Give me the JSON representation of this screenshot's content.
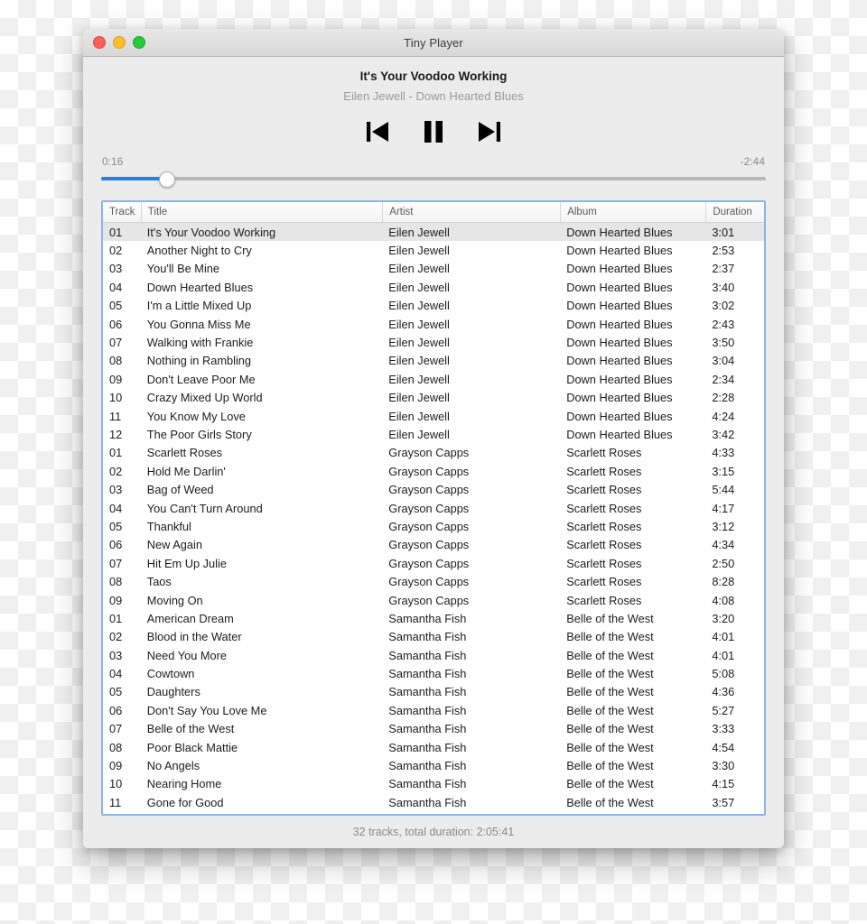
{
  "window": {
    "title": "Tiny Player",
    "traffic_lights": [
      {
        "name": "close",
        "color": "#ff5f57"
      },
      {
        "name": "minimize",
        "color": "#febc2e"
      },
      {
        "name": "maximize",
        "color": "#28c840"
      }
    ]
  },
  "now_playing": {
    "title": "It's Your Voodoo Working",
    "subtitle": "Eilen Jewell - Down Hearted Blues"
  },
  "transport": {
    "previous_icon": "skip-previous-icon",
    "playpause_icon": "pause-icon",
    "next_icon": "skip-next-icon"
  },
  "progress": {
    "elapsed": "0:16",
    "remaining": "-2:44",
    "percent": 9.8,
    "fill_color": "#1e82e6",
    "track_color": "#b8b8b8"
  },
  "table": {
    "columns": [
      "Track",
      "Title",
      "Artist",
      "Album",
      "Duration"
    ],
    "selected_index": 0,
    "rows": [
      {
        "track": "01",
        "title": "It's Your Voodoo Working",
        "artist": "Eilen Jewell",
        "album": "Down Hearted Blues",
        "duration": "3:01"
      },
      {
        "track": "02",
        "title": "Another Night to Cry",
        "artist": "Eilen Jewell",
        "album": "Down Hearted Blues",
        "duration": "2:53"
      },
      {
        "track": "03",
        "title": "You'll Be Mine",
        "artist": "Eilen Jewell",
        "album": "Down Hearted Blues",
        "duration": "2:37"
      },
      {
        "track": "04",
        "title": "Down Hearted Blues",
        "artist": "Eilen Jewell",
        "album": "Down Hearted Blues",
        "duration": "3:40"
      },
      {
        "track": "05",
        "title": "I'm a Little Mixed Up",
        "artist": "Eilen Jewell",
        "album": "Down Hearted Blues",
        "duration": "3:02"
      },
      {
        "track": "06",
        "title": "You Gonna Miss Me",
        "artist": "Eilen Jewell",
        "album": "Down Hearted Blues",
        "duration": "2:43"
      },
      {
        "track": "07",
        "title": "Walking with Frankie",
        "artist": "Eilen Jewell",
        "album": "Down Hearted Blues",
        "duration": "3:50"
      },
      {
        "track": "08",
        "title": "Nothing in Rambling",
        "artist": "Eilen Jewell",
        "album": "Down Hearted Blues",
        "duration": "3:04"
      },
      {
        "track": "09",
        "title": "Don't Leave Poor Me",
        "artist": "Eilen Jewell",
        "album": "Down Hearted Blues",
        "duration": "2:34"
      },
      {
        "track": "10",
        "title": "Crazy Mixed Up World",
        "artist": "Eilen Jewell",
        "album": "Down Hearted Blues",
        "duration": "2:28"
      },
      {
        "track": "11",
        "title": "You Know My Love",
        "artist": "Eilen Jewell",
        "album": "Down Hearted Blues",
        "duration": "4:24"
      },
      {
        "track": "12",
        "title": "The Poor Girls Story",
        "artist": "Eilen Jewell",
        "album": "Down Hearted Blues",
        "duration": "3:42"
      },
      {
        "track": "01",
        "title": "Scarlett Roses",
        "artist": "Grayson Capps",
        "album": "Scarlett Roses",
        "duration": "4:33"
      },
      {
        "track": "02",
        "title": "Hold Me Darlin'",
        "artist": "Grayson Capps",
        "album": "Scarlett Roses",
        "duration": "3:15"
      },
      {
        "track": "03",
        "title": "Bag of Weed",
        "artist": "Grayson Capps",
        "album": "Scarlett Roses",
        "duration": "5:44"
      },
      {
        "track": "04",
        "title": "You Can't Turn Around",
        "artist": "Grayson Capps",
        "album": "Scarlett Roses",
        "duration": "4:17"
      },
      {
        "track": "05",
        "title": "Thankful",
        "artist": "Grayson Capps",
        "album": "Scarlett Roses",
        "duration": "3:12"
      },
      {
        "track": "06",
        "title": "New Again",
        "artist": "Grayson Capps",
        "album": "Scarlett Roses",
        "duration": "4:34"
      },
      {
        "track": "07",
        "title": "Hit Em Up Julie",
        "artist": "Grayson Capps",
        "album": "Scarlett Roses",
        "duration": "2:50"
      },
      {
        "track": "08",
        "title": "Taos",
        "artist": "Grayson Capps",
        "album": "Scarlett Roses",
        "duration": "8:28"
      },
      {
        "track": "09",
        "title": "Moving On",
        "artist": "Grayson Capps",
        "album": "Scarlett Roses",
        "duration": "4:08"
      },
      {
        "track": "01",
        "title": "American Dream",
        "artist": "Samantha Fish",
        "album": "Belle of the West",
        "duration": "3:20"
      },
      {
        "track": "02",
        "title": "Blood in the Water",
        "artist": "Samantha Fish",
        "album": "Belle of the West",
        "duration": "4:01"
      },
      {
        "track": "03",
        "title": "Need You More",
        "artist": "Samantha Fish",
        "album": "Belle of the West",
        "duration": "4:01"
      },
      {
        "track": "04",
        "title": "Cowtown",
        "artist": "Samantha Fish",
        "album": "Belle of the West",
        "duration": "5:08"
      },
      {
        "track": "05",
        "title": "Daughters",
        "artist": "Samantha Fish",
        "album": "Belle of the West",
        "duration": "4:36"
      },
      {
        "track": "06",
        "title": "Don't Say You Love Me",
        "artist": "Samantha Fish",
        "album": "Belle of the West",
        "duration": "5:27"
      },
      {
        "track": "07",
        "title": "Belle of the West",
        "artist": "Samantha Fish",
        "album": "Belle of the West",
        "duration": "3:33"
      },
      {
        "track": "08",
        "title": "Poor Black Mattie",
        "artist": "Samantha Fish",
        "album": "Belle of the West",
        "duration": "4:54"
      },
      {
        "track": "09",
        "title": "No Angels",
        "artist": "Samantha Fish",
        "album": "Belle of the West",
        "duration": "3:30"
      },
      {
        "track": "10",
        "title": "Nearing Home",
        "artist": "Samantha Fish",
        "album": "Belle of the West",
        "duration": "4:15"
      },
      {
        "track": "11",
        "title": "Gone for Good",
        "artist": "Samantha Fish",
        "album": "Belle of the West",
        "duration": "3:57"
      }
    ]
  },
  "status": {
    "text": "32 tracks, total duration: 2:05:41"
  }
}
